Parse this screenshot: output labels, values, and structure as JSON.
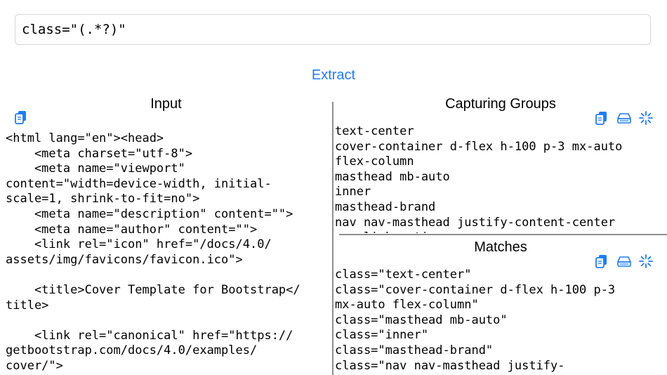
{
  "regex": {
    "value": "class=\"(.*?)\""
  },
  "extract_label": "Extract",
  "input": {
    "title": "Input",
    "text": "<html lang=\"en\"><head>\n    <meta charset=\"utf-8\">\n    <meta name=\"viewport\"\ncontent=\"width=device-width, initial-\nscale=1, shrink-to-fit=no\">\n    <meta name=\"description\" content=\"\">\n    <meta name=\"author\" content=\"\">\n    <link rel=\"icon\" href=\"/docs/4.0/\nassets/img/favicons/favicon.ico\">\n\n    <title>Cover Template for Bootstrap</\ntitle>\n\n    <link rel=\"canonical\" href=\"https://\ngetbootstrap.com/docs/4.0/examples/\ncover/\">"
  },
  "groups": {
    "title": "Capturing Groups",
    "text": "text-center\ncover-container d-flex h-100 p-3 mx-auto\nflex-column\nmasthead mb-auto\ninner\nmasthead-brand\nnav nav-masthead justify-content-center\nnav-link active"
  },
  "matches": {
    "title": "Matches",
    "text": "class=\"text-center\"\nclass=\"cover-container d-flex h-100 p-3\nmx-auto flex-column\"\nclass=\"masthead mb-auto\"\nclass=\"inner\"\nclass=\"masthead-brand\"\nclass=\"nav nav-masthead justify-"
  },
  "colors": {
    "accent": "#1f7df2",
    "divider": "#8f8f8f",
    "border": "#d6d6d6"
  },
  "icons": [
    "copy-icon",
    "keyboard-icon",
    "clear-icon"
  ]
}
